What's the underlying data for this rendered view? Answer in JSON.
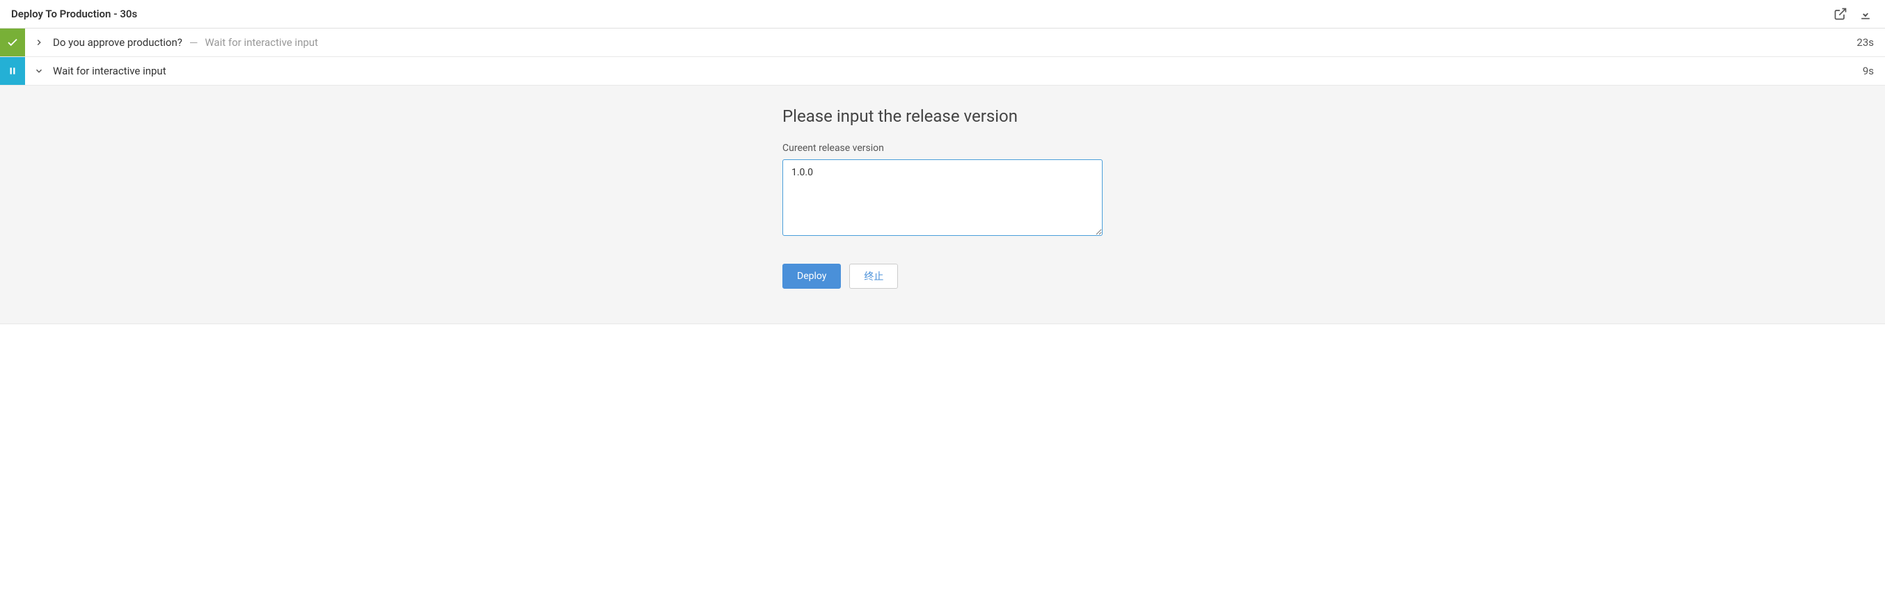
{
  "header": {
    "title": "Deploy To Production - 30s"
  },
  "steps": [
    {
      "status": "success",
      "expanded": false,
      "title": "Do you approve production?",
      "subtitle": "Wait for interactive input",
      "duration": "23s"
    },
    {
      "status": "paused",
      "expanded": true,
      "title": "Wait for interactive input",
      "subtitle": "",
      "duration": "9s"
    }
  ],
  "form": {
    "heading": "Please input the release version",
    "label": "Cureent release version",
    "value": "1.0.0",
    "primary_button": "Deploy",
    "secondary_button": "终止"
  }
}
